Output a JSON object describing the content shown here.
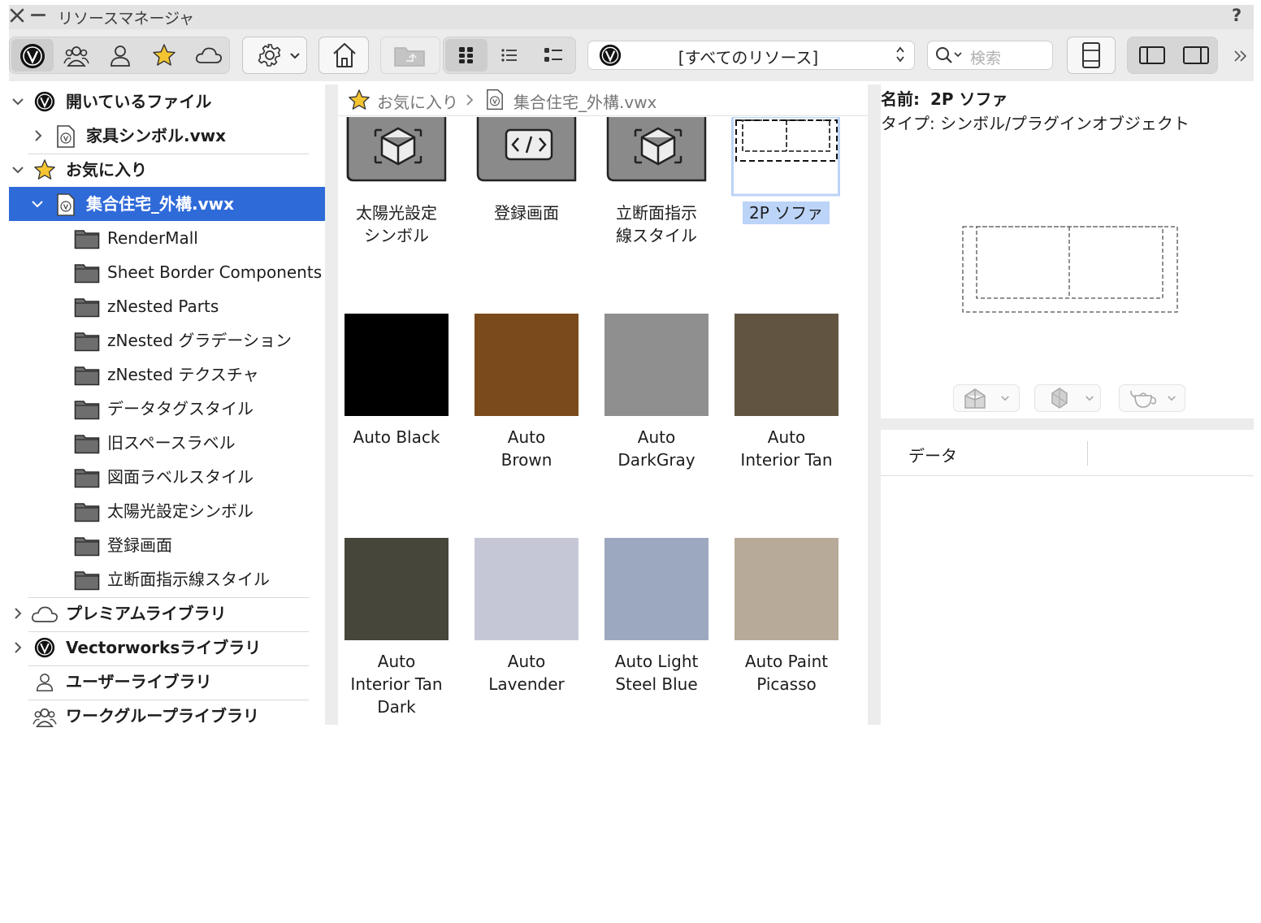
{
  "window": {
    "title": "リソースマネージャ",
    "help": "?"
  },
  "toolbar": {
    "filter_icons": [
      "vectorworks-logo-icon",
      "workgroup-icon",
      "user-icon",
      "star-icon",
      "cloud-icon"
    ],
    "library_select": "[すべてのリソース]",
    "search_placeholder": "検索"
  },
  "tree": {
    "open_files_label": "開いているファイル",
    "open_files": [
      {
        "label": "家具シンボル.vwx"
      }
    ],
    "favorites_label": "お気に入り",
    "favorite_file": "集合住宅_外構.vwx",
    "folders": [
      "RenderMall",
      "Sheet Border Components",
      "zNested Parts",
      "zNested グラデーション",
      "zNested テクスチャ",
      "データタグスタイル",
      "旧スペースラベル",
      "図面ラベルスタイル",
      "太陽光設定シンボル",
      "登録画面",
      "立断面指示線スタイル"
    ],
    "premium_label": "プレミアムライブラリ",
    "vectorworks_label": "Vectorworksライブラリ",
    "user_label": "ユーザーライブラリ",
    "workgroup_label": "ワークグループライブラリ"
  },
  "breadcrumb": {
    "root": "お気に入り",
    "file": "集合住宅_外構.vwx"
  },
  "resources_row1": [
    {
      "label1": "太陽光設定",
      "label2": "シンボル",
      "icon": "cube-icon"
    },
    {
      "label1": "登録画面",
      "label2": "",
      "icon": "code-icon"
    },
    {
      "label1": "立断面指示",
      "label2": "線スタイル",
      "icon": "cube-icon"
    },
    {
      "label1": "2P ソファ",
      "label2": "",
      "icon": "sofa-symbol-icon",
      "selected": true
    }
  ],
  "resources_row2": [
    {
      "label1": "Auto Black",
      "label2": "",
      "color": "#000000"
    },
    {
      "label1": "Auto",
      "label2": "Brown",
      "color": "#7b4a1b"
    },
    {
      "label1": "Auto",
      "label2": "DarkGray",
      "color": "#8f8f8f"
    },
    {
      "label1": "Auto",
      "label2": "Interior Tan",
      "color": "#615542"
    }
  ],
  "resources_row3": [
    {
      "label1": "Auto",
      "label2": "Interior Tan",
      "label3": "Dark",
      "color": "#47463a"
    },
    {
      "label1": "Auto",
      "label2": "Lavender",
      "label3": "",
      "color": "#c6c7d6"
    },
    {
      "label1": "Auto Light",
      "label2": "Steel Blue",
      "label3": "",
      "color": "#9ca8bf"
    },
    {
      "label1": "Auto Paint",
      "label2": "Picasso",
      "label3": "",
      "color": "#b8aa98"
    }
  ],
  "info": {
    "name_label": "名前:",
    "name_value": "2P ソファ",
    "type_line": "タイプ: シンボル/プラグインオブジェクト",
    "data_header": "データ"
  },
  "colors": {
    "selection": "#2f6ad9",
    "thumb_selection": "#bcd4f7"
  }
}
